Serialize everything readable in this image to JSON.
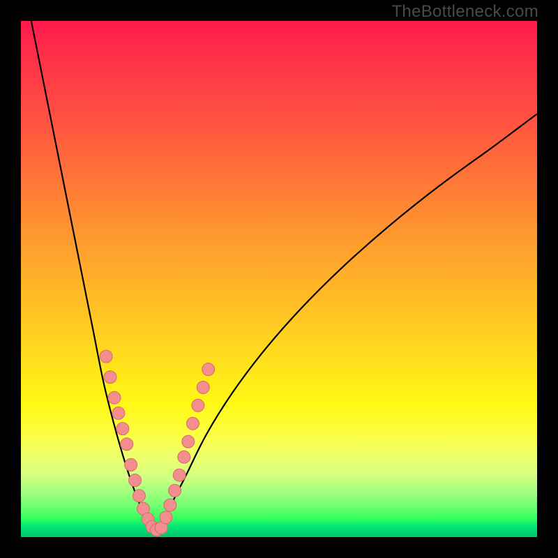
{
  "watermark": "TheBottleneck.com",
  "colors": {
    "background": "#000000",
    "curve": "#000000",
    "dot_fill": "#f28e8e",
    "dot_stroke": "#d86a6a",
    "gradient_stops": [
      "#ff1a4d",
      "#ff5540",
      "#ffa02d",
      "#ffe01c",
      "#fcff40",
      "#d6ff80",
      "#30ff60",
      "#00c46a"
    ]
  },
  "chart_data": {
    "type": "line",
    "title": "",
    "xlabel": "",
    "ylabel": "",
    "xlim": [
      0,
      100
    ],
    "ylim": [
      0,
      100
    ],
    "grid": false,
    "note": "V-shaped bottleneck curve. X is normalized horizontal position (0–100 left→right). Y is bottleneck percentage (0 at bottom/green, 100 at top/red). Values estimated from image geometry.",
    "series": [
      {
        "name": "curve-left",
        "x": [
          2,
          4,
          6,
          8,
          10,
          12,
          14,
          16,
          18,
          20,
          22,
          24,
          25.5
        ],
        "values": [
          100,
          90,
          80,
          70,
          60,
          50,
          40,
          30,
          22,
          15,
          9,
          4,
          1
        ]
      },
      {
        "name": "curve-right",
        "x": [
          27,
          29,
          32,
          36,
          41,
          47,
          54,
          62,
          71,
          81,
          92,
          100
        ],
        "values": [
          1,
          6,
          12,
          20,
          28,
          36,
          44,
          52,
          60,
          68,
          76,
          82
        ]
      }
    ],
    "dots": {
      "note": "Pink highlight dots along the curve near the valley. Same coordinate system as series.",
      "points": [
        [
          16.5,
          35
        ],
        [
          17.3,
          31
        ],
        [
          18.1,
          27
        ],
        [
          18.9,
          24
        ],
        [
          19.7,
          21
        ],
        [
          20.5,
          18
        ],
        [
          21.3,
          14
        ],
        [
          22.1,
          11
        ],
        [
          22.9,
          8
        ],
        [
          23.7,
          5.5
        ],
        [
          24.6,
          3.5
        ],
        [
          25.4,
          2
        ],
        [
          26.3,
          1.4
        ],
        [
          27.2,
          1.8
        ],
        [
          28.1,
          3.8
        ],
        [
          28.9,
          6.2
        ],
        [
          29.8,
          9
        ],
        [
          30.7,
          12
        ],
        [
          31.6,
          15.5
        ],
        [
          32.4,
          18.5
        ],
        [
          33.3,
          22
        ],
        [
          34.3,
          25.5
        ],
        [
          35.3,
          29
        ],
        [
          36.3,
          32.5
        ]
      ]
    }
  }
}
